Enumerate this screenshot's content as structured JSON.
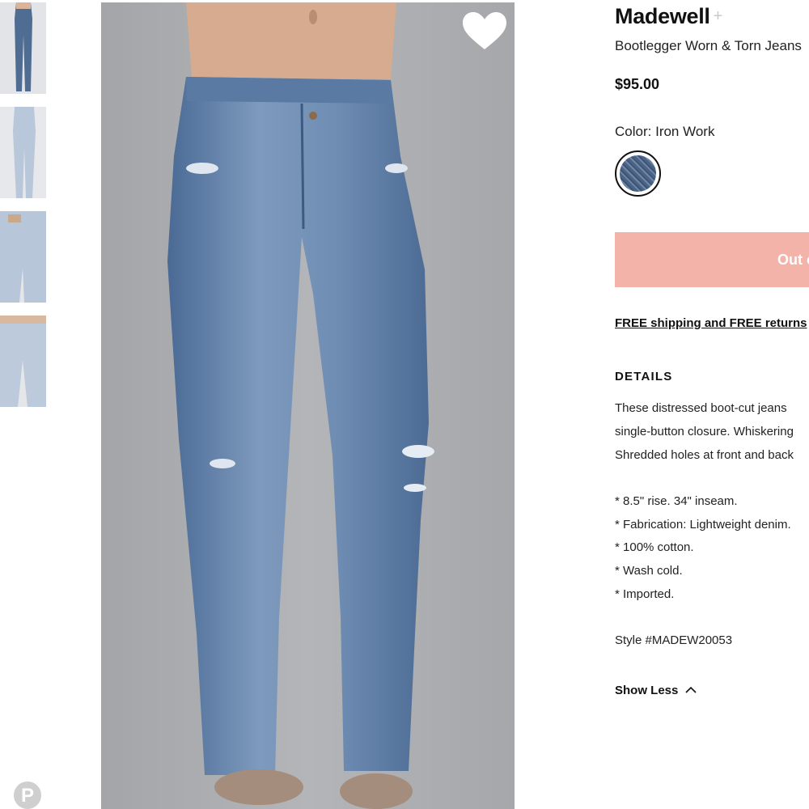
{
  "product": {
    "brand": "Madewell",
    "brand_follow_symbol": "+",
    "name": "Bootlegger Worn & Torn Jeans",
    "price": "$95.00",
    "color_label": "Color:",
    "color_value": "Iron Work",
    "swatch_color": "#4b6385",
    "cta_label": "Out of Stock",
    "cta_color": "#f3b3a8",
    "shipping_text": "FREE shipping and FREE returns"
  },
  "details": {
    "heading": "DETAILS",
    "description_lines": [
      "These distressed boot-cut jeans",
      "single-button closure. Whiskering",
      "Shredded holes at front and back"
    ],
    "bullets": [
      "* 8.5\" rise. 34\" inseam.",
      "* Fabrication: Lightweight denim.",
      "* 100% cotton.",
      "* Wash cold.",
      "* Imported."
    ],
    "style_number": "Style #MADEW20053",
    "toggle_label": "Show Less",
    "toggle_icon": "chevron-up-icon"
  },
  "gallery": {
    "thumbnail_count": 4,
    "wishlist_icon": "heart-icon",
    "share_icon": "pinterest-icon",
    "pinterest_glyph": "P"
  }
}
